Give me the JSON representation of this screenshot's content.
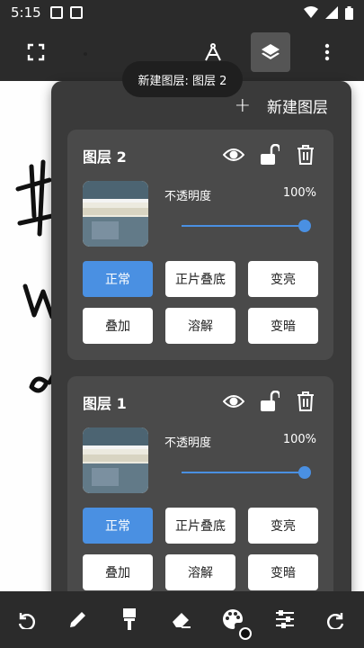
{
  "status_bar": {
    "time": "5:15"
  },
  "tooltip": "新建图层: 图层 2",
  "panel": {
    "new_layer_label": "新建图层",
    "layers": [
      {
        "name": "图层 2",
        "opacity_label": "不透明度",
        "opacity_value": "100%",
        "blend_modes": [
          "正常",
          "正片叠底",
          "变亮",
          "叠加",
          "溶解",
          "变暗"
        ],
        "active_blend": "正常"
      },
      {
        "name": "图层 1",
        "opacity_label": "不透明度",
        "opacity_value": "100%",
        "blend_modes": [
          "正常",
          "正片叠底",
          "变亮",
          "叠加",
          "溶解",
          "变暗"
        ],
        "active_blend": "正常"
      }
    ]
  },
  "icons": {
    "toolbar": [
      "fullscreen-icon",
      "compass-icon",
      "layers-icon",
      "more-vert-icon"
    ],
    "card": [
      "eye-icon",
      "unlock-icon",
      "trash-icon"
    ],
    "bottom": [
      "undo-icon",
      "pencil-icon",
      "brush-icon",
      "eraser-icon",
      "palette-icon",
      "sliders-icon",
      "redo-icon"
    ]
  },
  "colors": {
    "accent": "#4a90e2",
    "panel": "#3a3a3a",
    "card": "#4a4a4a"
  }
}
